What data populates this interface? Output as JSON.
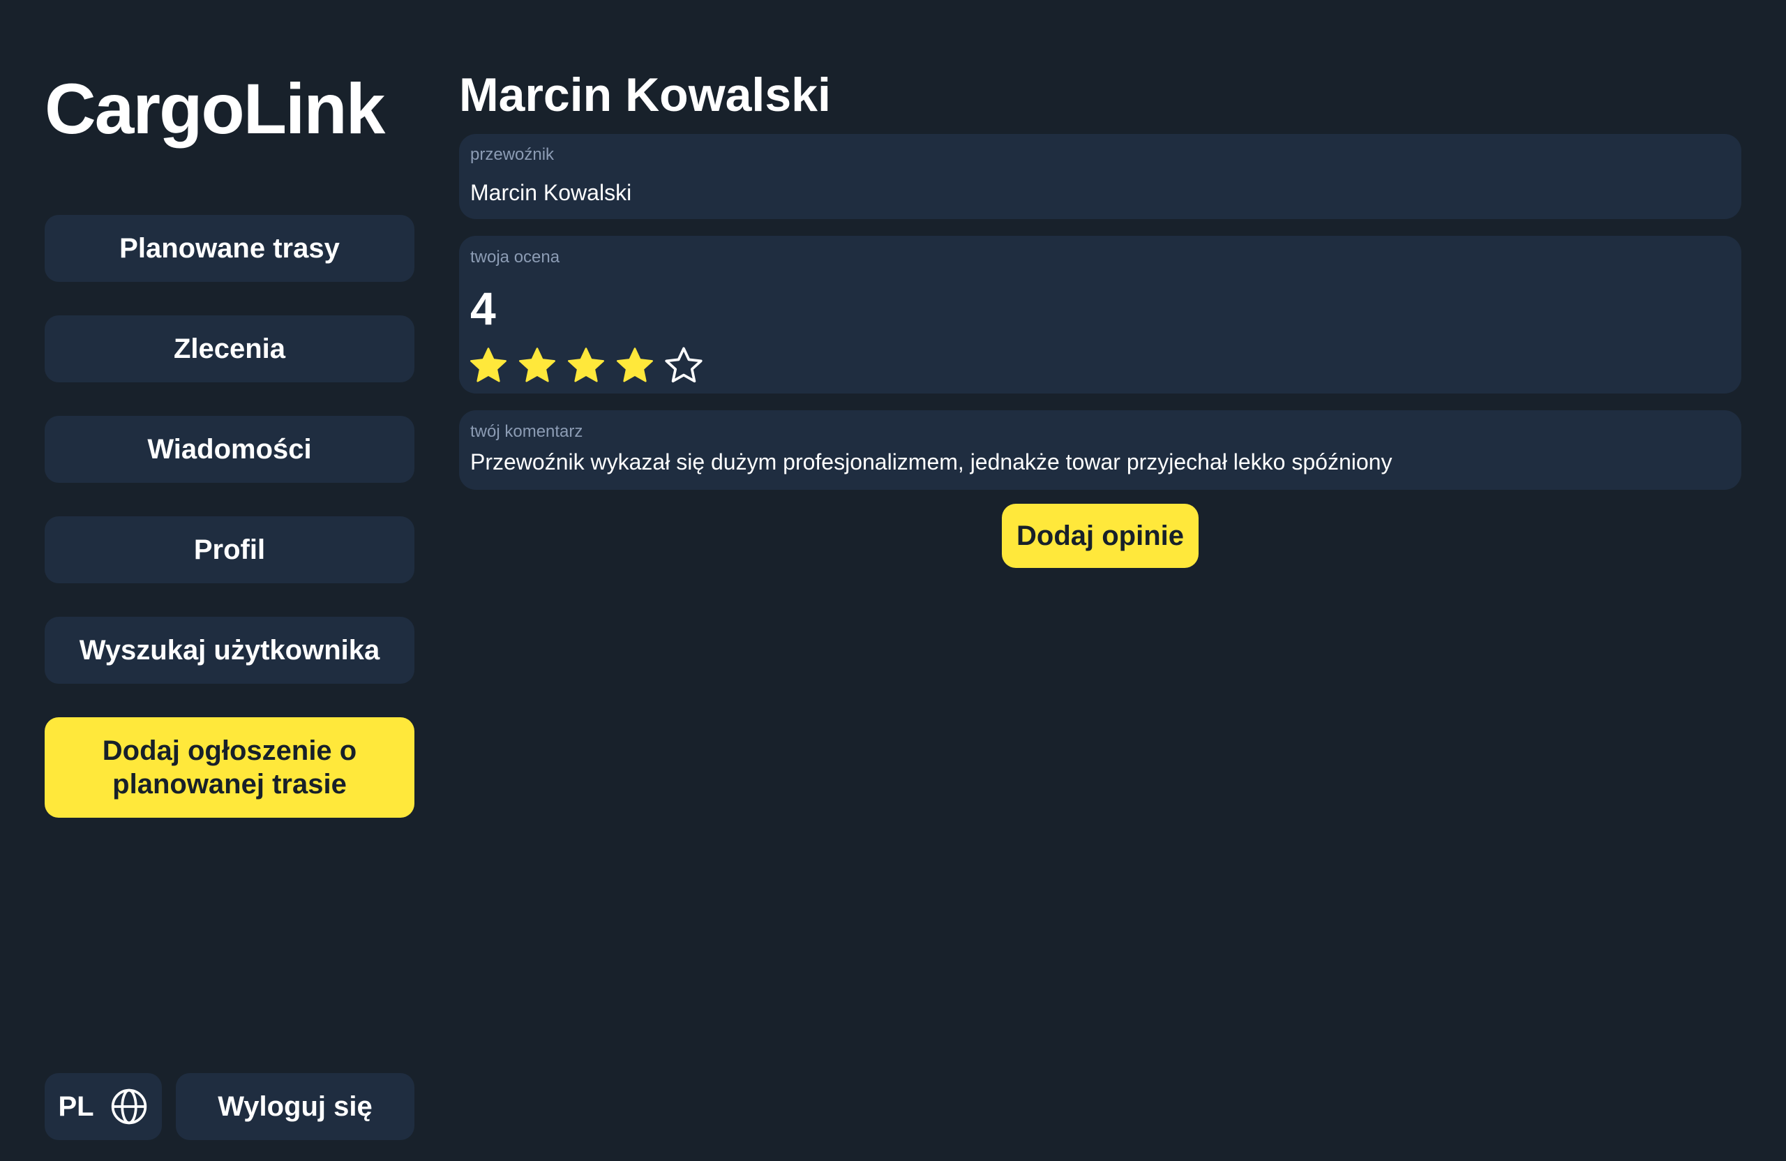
{
  "app": {
    "name": "CargoLink"
  },
  "sidebar": {
    "items": [
      {
        "label": "Planowane trasy"
      },
      {
        "label": "Zlecenia"
      },
      {
        "label": "Wiadomości"
      },
      {
        "label": "Profil"
      },
      {
        "label": "Wyszukaj użytkownika"
      }
    ],
    "cta_label": "Dodaj ogłoszenie o planowanej trasie",
    "language": {
      "label": "PL",
      "icon": "globe-icon"
    },
    "logout_label": "Wyloguj się"
  },
  "main": {
    "title": "Marcin Kowalski",
    "carrier": {
      "label": "przewoźnik",
      "value": "Marcin Kowalski"
    },
    "rating": {
      "label": "twoja ocena",
      "value": "4",
      "stars_filled": 4,
      "stars_total": 5
    },
    "comment": {
      "label": "twój komentarz",
      "value": "Przewoźnik wykazał się dużym profesjonalizmem, jednakże towar przyjechał lekko spóźniony"
    },
    "submit_label": "Dodaj opinie"
  },
  "colors": {
    "background": "#18212b",
    "panel": "#1f2d40",
    "accent": "#ffe83b",
    "label": "#8c9cb4"
  }
}
